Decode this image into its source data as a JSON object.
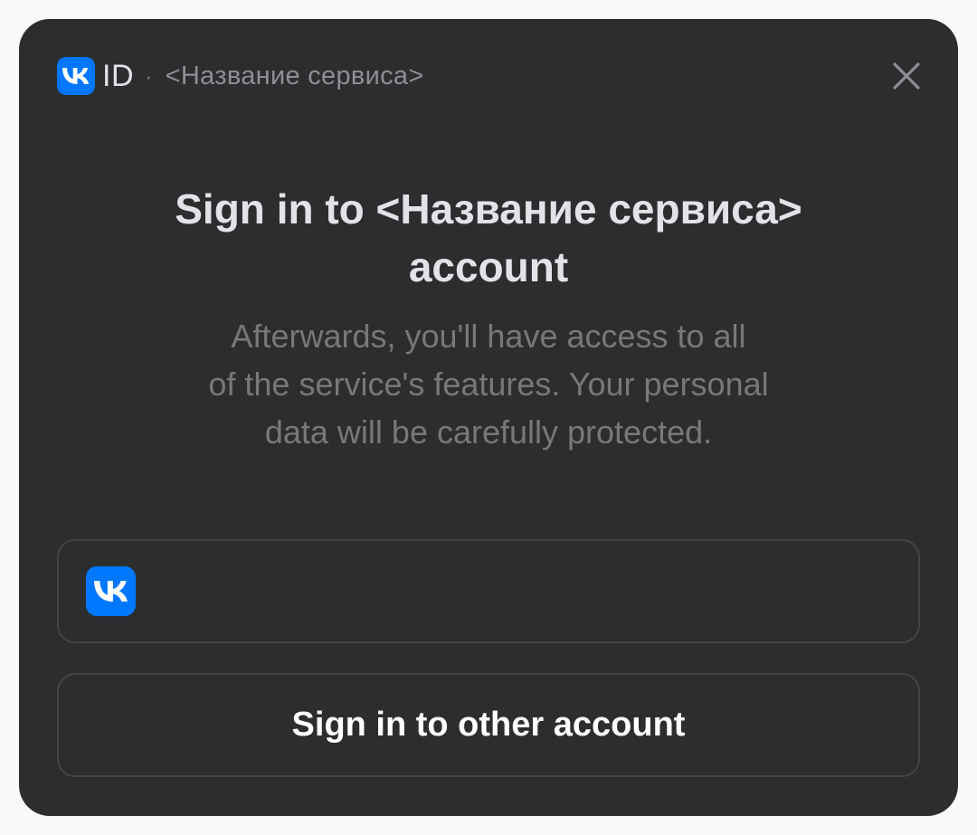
{
  "header": {
    "brand_id": "ID",
    "separator": "·",
    "service_name": "<Название сервиса>",
    "logo_icon": "vk-logo-icon",
    "close_icon": "close-icon"
  },
  "main": {
    "title_line1": "Sign in to <Название сервиса>",
    "title_line2": "account",
    "subtitle_line1": "Afterwards, you'll have access to all",
    "subtitle_line2": "of the service's features. Your personal",
    "subtitle_line3": "data will be carefully protected."
  },
  "buttons": {
    "vk_account_label": "",
    "other_account_label": "Sign in to other account"
  },
  "colors": {
    "sheet_background": "#2c2d2f",
    "page_background": "#f9f9f9",
    "vk_blue": "#0077ff",
    "primary_text": "#e1e3e6",
    "secondary_text": "#76787a",
    "button_border": "#444547"
  }
}
